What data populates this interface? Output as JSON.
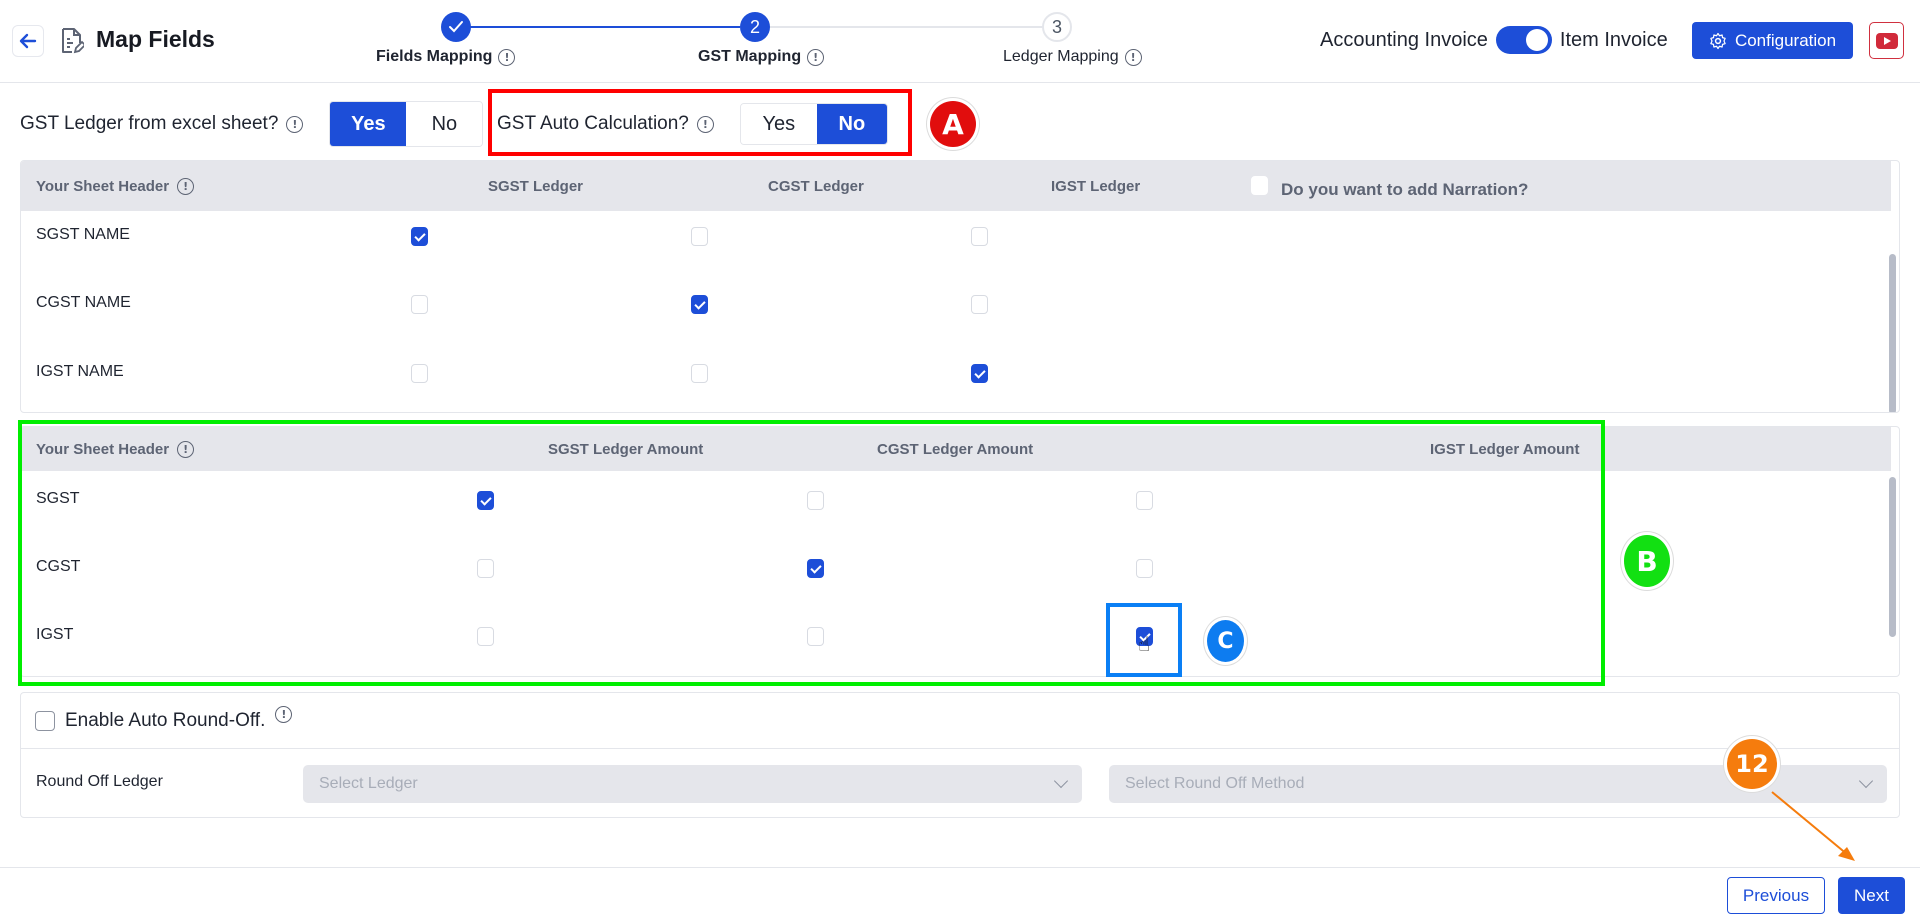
{
  "header": {
    "title": "Map Fields",
    "steps": [
      {
        "number": "1",
        "label": "Fields Mapping",
        "state": "done"
      },
      {
        "number": "2",
        "label": "GST Mapping",
        "state": "active"
      },
      {
        "number": "3",
        "label": "Ledger Mapping",
        "state": "pending"
      }
    ],
    "invoice_toggle": {
      "left_label": "Accounting Invoice",
      "right_label": "Item Invoice",
      "selected": "Item Invoice"
    },
    "configuration_label": "Configuration"
  },
  "options": {
    "gst_ledger_from_excel": {
      "label": "GST Ledger from excel sheet?",
      "choices": [
        "Yes",
        "No"
      ],
      "selected": "Yes"
    },
    "gst_auto_calculation": {
      "label": "GST Auto Calculation?",
      "choices": [
        "Yes",
        "No"
      ],
      "selected": "No"
    }
  },
  "ledger_table": {
    "headers": [
      "Your Sheet Header",
      "SGST Ledger",
      "CGST Ledger",
      "IGST Ledger"
    ],
    "narration_label": "Do you want to add Narration?",
    "narration_checked": false,
    "rows": [
      {
        "label": "SGST NAME",
        "checks": [
          true,
          false,
          false
        ]
      },
      {
        "label": "CGST NAME",
        "checks": [
          false,
          true,
          false
        ]
      },
      {
        "label": "IGST NAME",
        "checks": [
          false,
          false,
          true
        ]
      }
    ]
  },
  "amount_table": {
    "headers": [
      "Your Sheet Header",
      "SGST Ledger Amount",
      "CGST Ledger Amount",
      "IGST Ledger Amount"
    ],
    "rows": [
      {
        "label": "SGST",
        "checks": [
          true,
          false,
          false
        ]
      },
      {
        "label": "CGST",
        "checks": [
          false,
          true,
          false
        ]
      },
      {
        "label": "IGST",
        "checks": [
          false,
          false,
          true
        ]
      }
    ]
  },
  "round_off": {
    "enable_label": "Enable Auto Round-Off.",
    "enabled": false,
    "ledger_label": "Round Off Ledger",
    "ledger_placeholder": "Select Ledger",
    "method_placeholder": "Select Round Off Method"
  },
  "footer": {
    "previous_label": "Previous",
    "next_label": "Next"
  },
  "annotations": {
    "a": "A",
    "b": "B",
    "c": "C",
    "step": "12"
  },
  "colors": {
    "primary": "#1d4ed8",
    "annot_a": "#ff0000",
    "annot_b": "#00ee00",
    "annot_c": "#0a7ff5",
    "annot_step": "#f57c0d"
  }
}
